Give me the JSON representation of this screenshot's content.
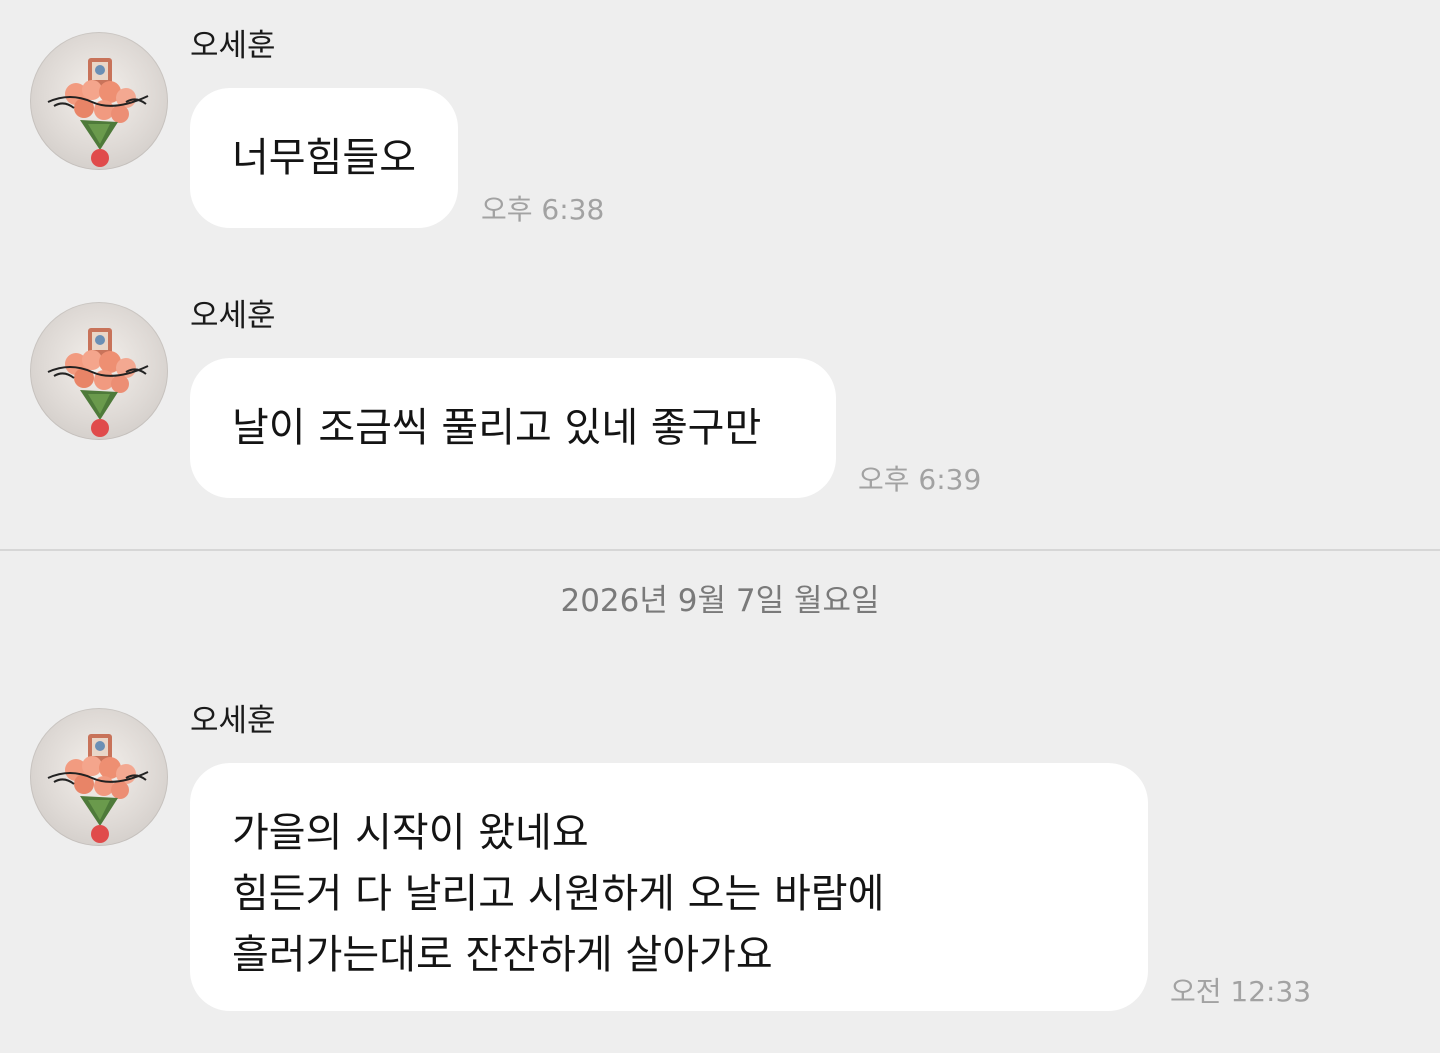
{
  "messages": [
    {
      "sender": "오세훈",
      "text": "너무힘들오",
      "time": "오후 6:38"
    },
    {
      "sender": "오세훈",
      "text": "날이 조금씩 풀리고 있네 좋구만",
      "time": "오후 6:39"
    },
    {
      "sender": "오세훈",
      "lines": [
        "가을의 시작이 왔네요",
        "힘든거 다 날리고 시원하게 오는 바람에",
        "흘러가는대로 잔잔하게 살아가요"
      ],
      "time": "오전 12:33"
    }
  ],
  "date_separator": "2026년 9월 7일 월요일",
  "colors": {
    "background": "#eeeeee",
    "bubble": "#ffffff",
    "timestamp": "#a2a2a2",
    "date_text": "#7a7a7a"
  },
  "icons": {
    "avatar": "profile-photo-flower-bouquet"
  }
}
